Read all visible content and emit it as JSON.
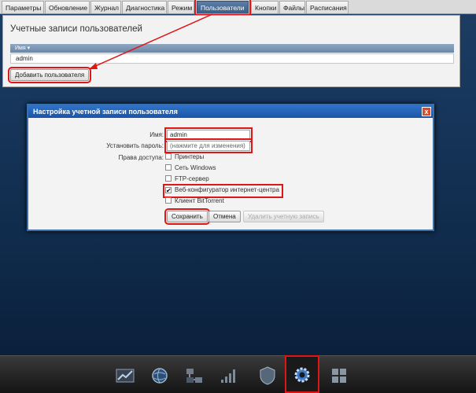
{
  "tabs": [
    "Параметры",
    "Обновление",
    "Журнал",
    "Диагностика",
    "Режим",
    "Пользователи",
    "Кнопки",
    "Файлы",
    "Расписания"
  ],
  "panel": {
    "title": "Учетные записи пользователей",
    "column_header": "Имя ▾",
    "rows": [
      "admin"
    ],
    "add_button": "Добавить пользователя"
  },
  "dialog": {
    "title": "Настройка учетной записи пользователя",
    "close": "x",
    "name_label": "Имя:",
    "name_value": "admin",
    "password_label": "Установить пароль:",
    "password_placeholder": "(нажмите для изменения)",
    "access_label": "Права доступа:",
    "permissions": [
      {
        "label": "Принтеры",
        "checked": false
      },
      {
        "label": "Сеть Windows",
        "checked": false
      },
      {
        "label": "FTP-сервер",
        "checked": false
      },
      {
        "label": "Веб-конфигуратор интернет-центра",
        "checked": true
      },
      {
        "label": "Клиент BitTorrent",
        "checked": false
      }
    ],
    "save_button": "Сохранить",
    "cancel_button": "Отмена",
    "delete_button": "Удалить учетную запись"
  },
  "taskbar": {
    "icons": [
      "chart-icon",
      "globe-icon",
      "network-icon",
      "signal-icon",
      "shield-icon",
      "gear-icon",
      "grid-icon"
    ],
    "active": "gear-icon"
  },
  "colors": {
    "highlight": "#e01515",
    "dialog_title": "#1a54a6",
    "active_tab": "#3b5d86"
  }
}
